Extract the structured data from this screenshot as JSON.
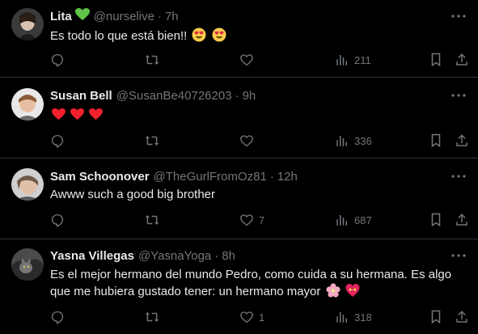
{
  "tweets": [
    {
      "name": "Lita",
      "badge": "green-heart",
      "handle": "@nurselive",
      "time": "7h",
      "text": "Es todo lo que está bien!!",
      "emojis": [
        "heart-eyes",
        "heart-eyes"
      ],
      "likes": "",
      "views": "211"
    },
    {
      "name": "Susan Bell",
      "handle": "@SusanBe40726203",
      "time": "9h",
      "text": "",
      "emojis": [
        "red-heart",
        "red-heart",
        "red-heart"
      ],
      "likes": "",
      "views": "336"
    },
    {
      "name": "Sam Schoonover",
      "handle": "@TheGurlFromOz81",
      "time": "12h",
      "text": "Awww such a good big brother",
      "likes": "7",
      "views": "687"
    },
    {
      "name": "Yasna Villegas",
      "handle": "@YasnaYoga",
      "time": "8h",
      "text": "Es el mejor hermano del mundo Pedro, como cuida a su hermana. Es algo que me hubiera gustado tener: un hermano mayor",
      "emojis": [
        "cherry-blossom",
        "heart-with-ribbon"
      ],
      "likes": "1",
      "views": "318"
    }
  ],
  "separator": "·",
  "colors": {
    "background": "#000000",
    "text": "#e7e9ea",
    "muted": "#71767b",
    "border": "#2f3336",
    "heart_red": "#f4212e",
    "verified_green": "#5ec44a"
  }
}
